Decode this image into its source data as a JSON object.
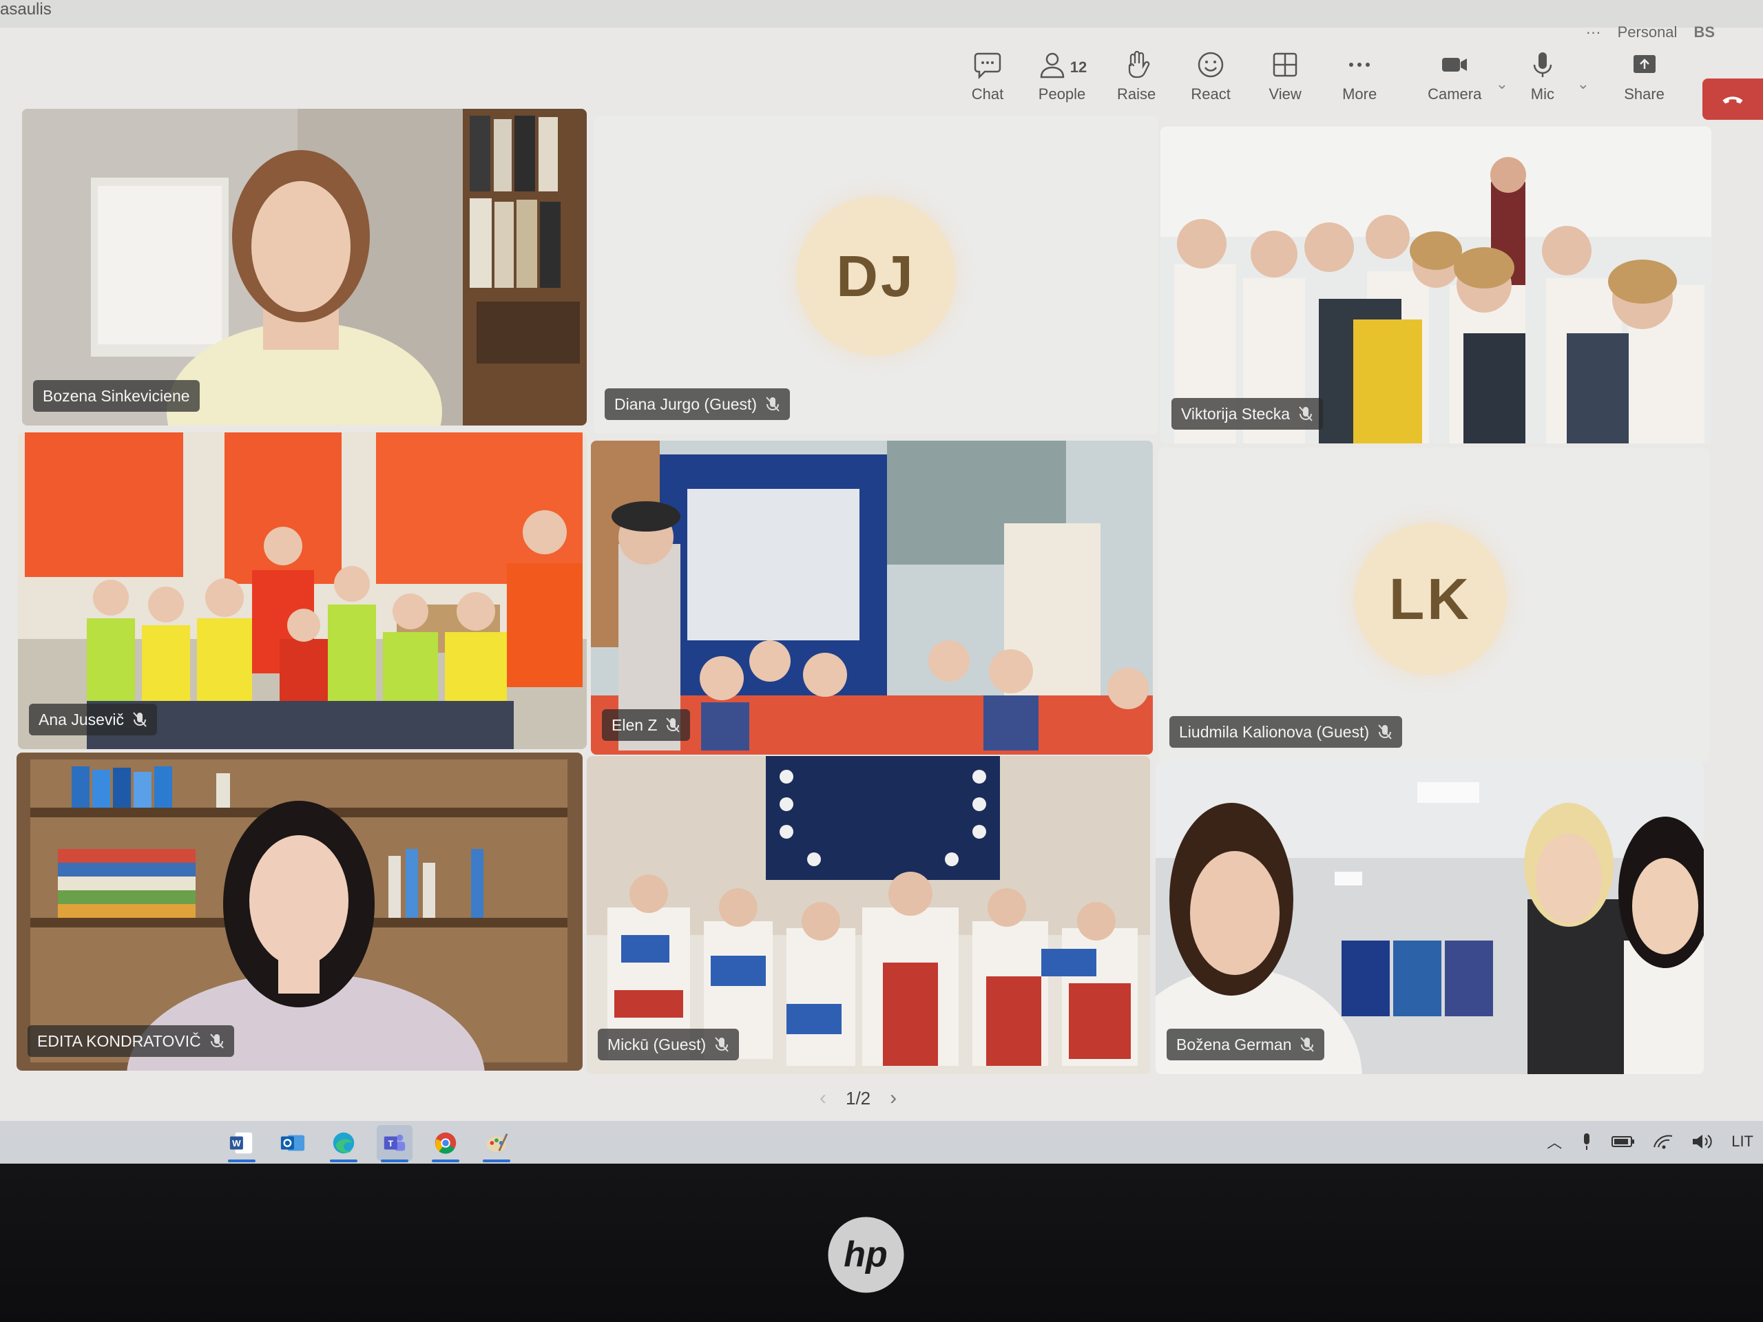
{
  "window": {
    "title": "asaulis",
    "more_label": "···",
    "account_label": "Personal",
    "account_initials": "BS"
  },
  "toolbar": {
    "chat": "Chat",
    "people": "People",
    "people_count": "12",
    "raise": "Raise",
    "react": "React",
    "view": "View",
    "more": "More",
    "camera": "Camera",
    "mic": "Mic",
    "share": "Share"
  },
  "participants": [
    {
      "name": "Bozena Sinkeviciene",
      "muted": false,
      "type": "video"
    },
    {
      "name": "Diana Jurgo (Guest)",
      "muted": true,
      "type": "avatar",
      "initials": "DJ"
    },
    {
      "name": "Viktorija Stecka",
      "muted": true,
      "type": "video"
    },
    {
      "name": "Ana Jusevič",
      "muted": true,
      "type": "video"
    },
    {
      "name": "Elen Z",
      "muted": true,
      "type": "video"
    },
    {
      "name": "Liudmila Kalionova (Guest)",
      "muted": true,
      "type": "avatar",
      "initials": "LK"
    },
    {
      "name": "EDITA KONDRATOVIČ",
      "muted": true,
      "type": "video"
    },
    {
      "name": "Mickū (Guest)",
      "muted": true,
      "type": "video"
    },
    {
      "name": "Božena German",
      "muted": true,
      "type": "video"
    }
  ],
  "pager": {
    "label": "1/2"
  },
  "taskbar": {
    "apps": [
      "word-icon",
      "outlook-icon",
      "edge-icon",
      "teams-icon",
      "chrome-icon",
      "paint-icon"
    ],
    "language": "LIT"
  },
  "device": {
    "brand": "hp"
  }
}
